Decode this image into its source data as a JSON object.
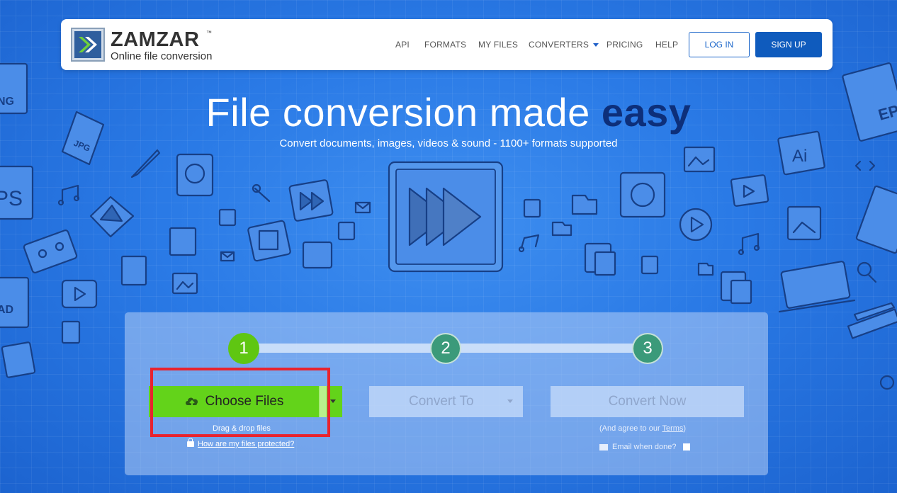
{
  "colors": {
    "brand_blue": "#2a7ae6",
    "primary_button": "#0f5bbd",
    "choose_green": "#63d31a",
    "highlight_red": "#e8232e",
    "easy_word": "#0d2f7a"
  },
  "header": {
    "logo_name": "ZAMZAR",
    "logo_tm": "™",
    "logo_tagline": "Online file conversion",
    "nav": {
      "api": "API",
      "formats": "FORMATS",
      "my_files": "MY FILES",
      "converters": "CONVERTERS",
      "pricing": "PRICING",
      "help": "HELP"
    },
    "login_label": "LOG IN",
    "signup_label": "SIGN UP"
  },
  "hero": {
    "title_main": "File conversion made ",
    "title_emphasis": "easy",
    "subtitle": "Convert documents, images, videos & sound - 1100+ formats supported"
  },
  "decor_texts": {
    "jpg": "JPG",
    "ps": "PS",
    "ai": "Ai",
    "png": "NG",
    "ep": "EP",
    "ad": "AD"
  },
  "converter": {
    "steps": [
      "1",
      "2",
      "3"
    ],
    "choose_files_label": "Choose Files",
    "drag_drop_hint": "Drag & drop files",
    "protection_link": "How are my files protected?",
    "convert_to_label": "Convert To",
    "convert_now_label": "Convert Now",
    "agree_prefix": "(And agree to our ",
    "agree_terms": "Terms",
    "agree_suffix": ")",
    "email_label": "Email when done?"
  }
}
